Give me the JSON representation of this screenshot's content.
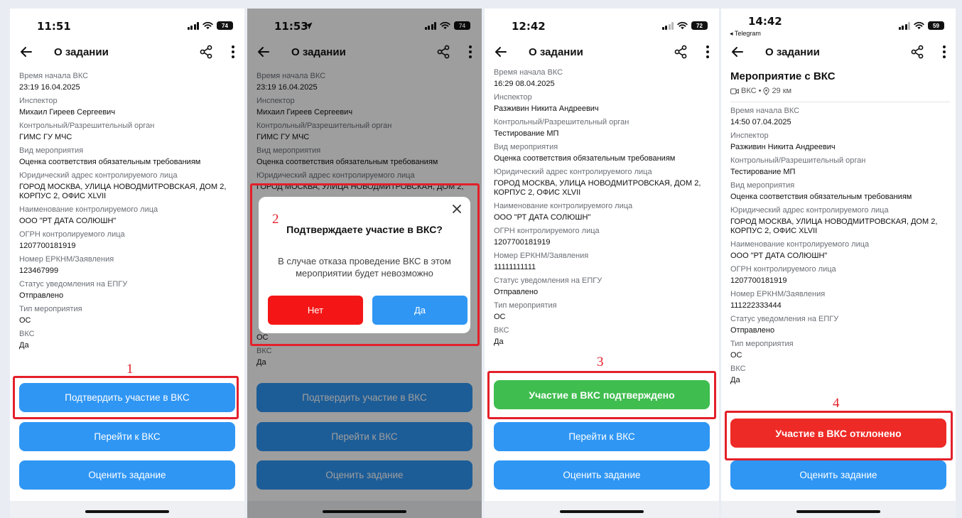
{
  "colors": {
    "primary": "#2f96f4",
    "success": "#3fbd4f",
    "danger": "#ee2a26",
    "highlight": "#e3202a"
  },
  "icons": [
    "back-arrow-icon",
    "share-icon",
    "more-vert-icon",
    "signal-icon",
    "wifi-icon",
    "battery-icon",
    "location-arrow-icon",
    "close-icon",
    "video-icon",
    "pin-icon"
  ],
  "screens": [
    {
      "time": "11:51",
      "battery": "74",
      "header": {
        "title": "О задании"
      },
      "fields": [
        {
          "label": "Время начала ВКС",
          "value": "23:19 16.04.2025"
        },
        {
          "label": "Инспектор",
          "value": "Михаил Гиреев Сергеевич"
        },
        {
          "label": "Контрольный/Разрешительный орган",
          "value": "ГИМС ГУ МЧС"
        },
        {
          "label": "Вид мероприятия",
          "value": "Оценка соответствия обязательным требованиям"
        },
        {
          "label": "Юридический адрес контролируемого лица",
          "value": "ГОРОД МОСКВА, УЛИЦА НОВОДМИТРОВСКАЯ, ДОМ 2, КОРПУС 2, ОФИС XLVII"
        },
        {
          "label": "Наименование контролируемого лица",
          "value": "ООО \"РТ ДАТА СОЛЮШН\""
        },
        {
          "label": "ОГРН контролируемого лица",
          "value": "1207700181919"
        },
        {
          "label": "Номер ЕРКНМ/Заявления",
          "value": "123467999"
        },
        {
          "label": "Статус уведомления на ЕПГУ",
          "value": "Отправлено"
        },
        {
          "label": "Тип мероприятия",
          "value": "ОС"
        },
        {
          "label": "ВКС",
          "value": "Да"
        }
      ],
      "buttons": {
        "confirm": "Подтвердить участие в ВКС",
        "goto": "Перейти к ВКС",
        "rate": "Оценить задание"
      },
      "annotation": "1"
    },
    {
      "time": "11:53",
      "battery": "74",
      "header": {
        "title": "О задании"
      },
      "fields": [
        {
          "label": "Время начала ВКС",
          "value": "23:19 16.04.2025"
        },
        {
          "label": "Инспектор",
          "value": "Михаил Гиреев Сергеевич"
        },
        {
          "label": "Контрольный/Разрешительный орган",
          "value": "ГИМС ГУ МЧС"
        },
        {
          "label": "Вид мероприятия",
          "value": "Оценка соответствия обязательным требованиям"
        },
        {
          "label": "Юридический адрес контролируемого лица",
          "value": "ГОРОД МОСКВА, УЛИЦА НОВОДМИТРОВСКАЯ, ДОМ 2,"
        }
      ],
      "tail": [
        {
          "value": "ОС"
        },
        {
          "label": "ВКС",
          "value": "Да"
        }
      ],
      "dialog": {
        "title": "Подтверждаете участие в ВКС?",
        "text": "В случае отказа проведение ВКС в этом мероприятии будет невозможно",
        "no": "Нет",
        "yes": "Да"
      },
      "buttons": {
        "confirm": "Подтвердить участие в ВКС",
        "goto": "Перейти к ВКС",
        "rate": "Оценить задание"
      },
      "annotation": "2"
    },
    {
      "time": "12:42",
      "battery": "72",
      "header": {
        "title": "О задании"
      },
      "fields": [
        {
          "label": "Время начала ВКС",
          "value": "16:29 08.04.2025"
        },
        {
          "label": "Инспектор",
          "value": "Разживин Никита Андреевич"
        },
        {
          "label": "Контрольный/Разрешительный орган",
          "value": "Тестирование МП"
        },
        {
          "label": "Вид мероприятия",
          "value": "Оценка соответствия обязательным требованиям"
        },
        {
          "label": "Юридический адрес контролируемого лица",
          "value": "ГОРОД МОСКВА, УЛИЦА НОВОДМИТРОВСКАЯ, ДОМ 2, КОРПУС 2, ОФИС XLVII"
        },
        {
          "label": "Наименование контролируемого лица",
          "value": "ООО \"РТ ДАТА СОЛЮШН\""
        },
        {
          "label": "ОГРН контролируемого лица",
          "value": "1207700181919"
        },
        {
          "label": "Номер ЕРКНМ/Заявления",
          "value": "11111111111"
        },
        {
          "label": "Статус уведомления на ЕПГУ",
          "value": "Отправлено"
        },
        {
          "label": "Тип мероприятия",
          "value": "ОС"
        },
        {
          "label": "ВКС",
          "value": "Да"
        }
      ],
      "buttons": {
        "confirmed": "Участие в ВКС подтверждено",
        "goto": "Перейти к ВКС",
        "rate": "Оценить задание"
      },
      "annotation": "3"
    },
    {
      "time": "14:42",
      "battery": "59",
      "back_app": "◂ Telegram",
      "header": {
        "title": "О задании"
      },
      "event": {
        "title": "Мероприятие с ВКС",
        "type": "ВКС",
        "distance": "29 км"
      },
      "fields": [
        {
          "label": "Время начала ВКС",
          "value": "14:50 07.04.2025"
        },
        {
          "label": "Инспектор",
          "value": "Разживин Никита Андреевич"
        },
        {
          "label": "Контрольный/Разрешительный орган",
          "value": "Тестирование МП"
        },
        {
          "label": "Вид мероприятия",
          "value": "Оценка соответствия обязательным требованиям"
        },
        {
          "label": "Юридический адрес контролируемого лица",
          "value": "ГОРОД МОСКВА, УЛИЦА НОВОДМИТРОВСКАЯ, ДОМ 2, КОРПУС 2, ОФИС XLVII"
        },
        {
          "label": "Наименование контролируемого лица",
          "value": "ООО \"РТ ДАТА СОЛЮШН\""
        },
        {
          "label": "ОГРН контролируемого лица",
          "value": "1207700181919"
        },
        {
          "label": "Номер ЕРКНМ/Заявления",
          "value": "111222333444"
        },
        {
          "label": "Статус уведомления на ЕПГУ",
          "value": "Отправлено"
        },
        {
          "label": "Тип мероприятия",
          "value": "ОС"
        },
        {
          "label": "ВКС",
          "value": "Да"
        }
      ],
      "buttons": {
        "declined": "Участие в ВКС отклонено",
        "rate": "Оценить задание"
      },
      "annotation": "4"
    }
  ]
}
